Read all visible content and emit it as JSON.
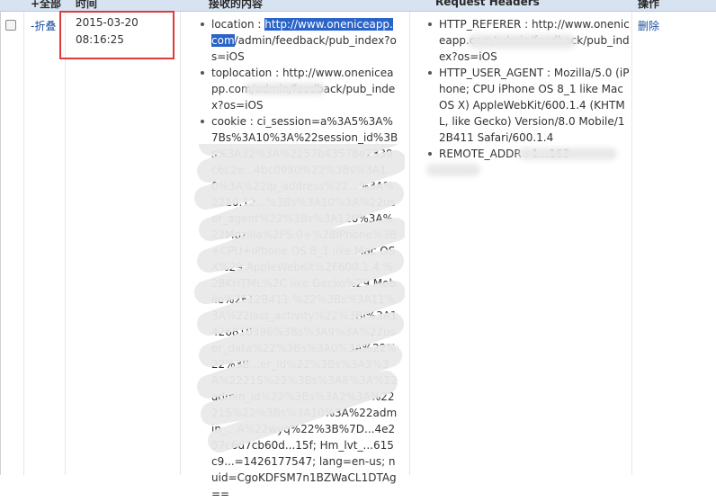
{
  "header": {
    "select_all": "+全部",
    "time": "时间",
    "received": "接收的内容",
    "request_headers": "Request Headers",
    "action": "操作"
  },
  "row": {
    "fold": "-折叠",
    "timestamp_date": "2015-03-20",
    "timestamp_time": "08:16:25",
    "received": {
      "location": "location : http://www.oneniceapp.com/admin/feedback/pub_index?os=iOS",
      "location_prefix": "location : ",
      "location_selected": "http://www.oneniceapp.com",
      "location_suffix": "/admin/feedback/pub_index?os=iOS",
      "toplocation": "toplocation : http://www.oneniceapp.com/admin/feedback/pub_index?os=iOS",
      "cookie": "cookie : ci_session=a%3A5%3A%7Bs%3A10%3A%22session_id%3Bs%3A32%3A%2257b43578e2339c6c2e...4bc0980%22%3Bs%3A10%3A%22ip_address%22...%3A%2210.12...%3Bs%3A10%3A%22user_agent%22%3Bs%3A120%3A%22Mozilla%2F5.0+%28iPhone%3B+CPU+iPhone OS 8_1 like Mac OS X%29 AppleWebKit%2F600.1.4 %28KHTML%2C like Gecko%29 Mobile%2F12B411 %22%3Bs%3A11%3A%22last_activity%22%3Bi%3A1426810396%3Bs%3A9%3A%22user_data%22%3Bs%3A0%3A%22%22%3B...er_id%22%3Bs%3A3%3A%22215%22%3Bs%3A8%3A%22admin_id%22%3Bs%3A2%3A%22215%22%3Bs%3A10%3A%22admin_...A%22wyq%22%3B%7D...4e257c6d7cb60d...15f; Hm_lvt_...615c9...=1426177547; lang=en-us; nuid=CgoKDFSM7n1BZWaCL1DTAg=="
    },
    "headers": {
      "referer": "HTTP_REFERER : http://www.oneniceapp.com/admin/feedback/pub_index?os=iOS",
      "user_agent": "HTTP_USER_AGENT : Mozilla/5.0 (iPhone; CPU iPhone OS 8_1 like Mac OS X) AppleWebKit/600.1.4 (KHTML, like Gecko) Version/8.0 Mobile/12B411 Safari/600.1.4",
      "remote_addr": "REMOTE_ADDR : 1...163"
    },
    "delete": "删除"
  }
}
